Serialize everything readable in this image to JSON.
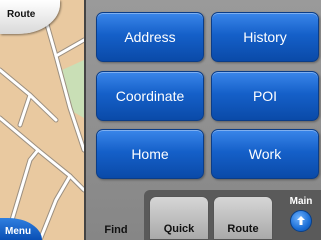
{
  "map": {
    "route_label": "Route",
    "menu_label": "Menu"
  },
  "find_buttons": [
    {
      "label": "Address"
    },
    {
      "label": "History"
    },
    {
      "label": "Coordinate"
    },
    {
      "label": "POI"
    },
    {
      "label": "Home"
    },
    {
      "label": "Work"
    }
  ],
  "tabs": {
    "find": "Find",
    "quick": "Quick",
    "route": "Route",
    "main": "Main"
  },
  "colors": {
    "button_blue": "#1560c9",
    "panel_gray": "#8d8d8d",
    "map_land": "#e9c9a0",
    "map_green": "#c9dfb6"
  }
}
